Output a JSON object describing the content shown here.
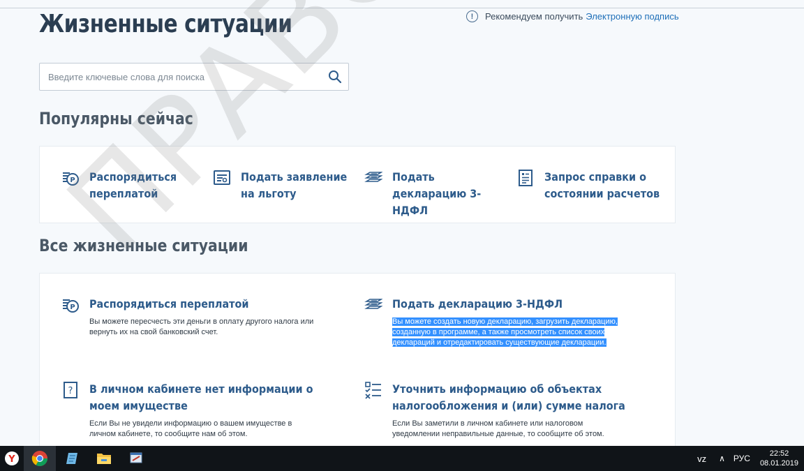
{
  "page": {
    "title": "Жизненные ситуации",
    "notice_text": "Рекомендуем получить",
    "notice_link": "Электронную подпись",
    "search_placeholder": "Введите ключевые слова для поиска"
  },
  "popular": {
    "title": "Популярны сейчас",
    "items": [
      {
        "label": "Распорядиться переплатой",
        "icon": "ruble-coins-icon"
      },
      {
        "label": "Подать заявление на льготу",
        "icon": "document-form-icon"
      },
      {
        "label": "Подать декларацию 3-НДФЛ",
        "icon": "declaration-stack-icon"
      },
      {
        "label": "Запрос справки о состоянии расчетов",
        "icon": "document-list-icon"
      }
    ]
  },
  "all": {
    "title": "Все жизненные ситуации",
    "items": [
      {
        "title": "Распорядиться переплатой",
        "desc": "Вы можете пересчесть эти деньги в оплату другого налога или вернуть их на свой банковский счет.",
        "icon": "ruble-coins-icon"
      },
      {
        "title": "Подать декларацию 3-НДФЛ",
        "desc": "Вы можете создать новую декларацию, загрузить декларацию, созданную в программе, а также просмотреть список своих деклараций и отредактировать существующие декларации.",
        "icon": "declaration-stack-icon"
      },
      {
        "title": "В личном кабинете нет информации о моем имуществе",
        "desc": "Если Вы не увидели информацию о вашем имуществе в личном кабинете, то сообщите нам об этом.",
        "icon": "question-icon"
      },
      {
        "title": "Уточнить информацию об объектах налогообложения и (или) сумме налога",
        "desc": "Если Вы заметили в личном кабинете или налоговом уведомлении неправильные данные, то сообщите об этом.",
        "icon": "checklist-icon"
      }
    ]
  },
  "watermark": "ПРАВОТОК",
  "taskbar": {
    "apps": [
      "yandex-browser-icon",
      "chrome-icon",
      "notepad-icon",
      "file-explorer-icon",
      "app-window-icon"
    ],
    "lang": "РУС",
    "time": "22:52",
    "date": "08.01.2019"
  },
  "colors": {
    "accent": "#2d5b8b",
    "link": "#1e6fb8",
    "highlight": "#3390ff"
  }
}
